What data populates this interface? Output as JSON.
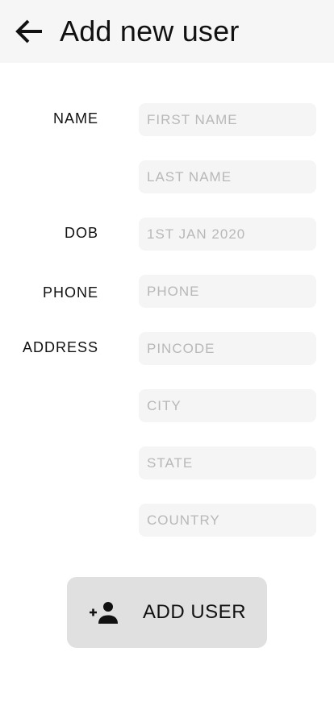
{
  "header": {
    "title": "Add new user",
    "back_icon": "arrow-back-icon"
  },
  "form": {
    "labels": {
      "name": "NAME",
      "dob": "DOB",
      "phone": "PHONE",
      "address": "ADDRESS"
    },
    "fields": {
      "first_name": {
        "placeholder": "FIRST NAME",
        "value": ""
      },
      "last_name": {
        "placeholder": "LAST NAME",
        "value": ""
      },
      "dob": {
        "placeholder": "1ST JAN 2020",
        "value": ""
      },
      "phone": {
        "placeholder": "PHONE",
        "value": ""
      },
      "pincode": {
        "placeholder": "PINCODE",
        "value": ""
      },
      "city": {
        "placeholder": "CITY",
        "value": ""
      },
      "state": {
        "placeholder": "STATE",
        "value": ""
      },
      "country": {
        "placeholder": "COUNTRY",
        "value": ""
      }
    }
  },
  "actions": {
    "add_user_label": "ADD USER",
    "add_user_icon": "person-add-icon"
  },
  "colors": {
    "app_bar_bg": "#f6f6f6",
    "field_bg": "#f5f5f5",
    "placeholder": "#b8b8b8",
    "button_bg": "#e0e0e0",
    "text": "#111111"
  }
}
